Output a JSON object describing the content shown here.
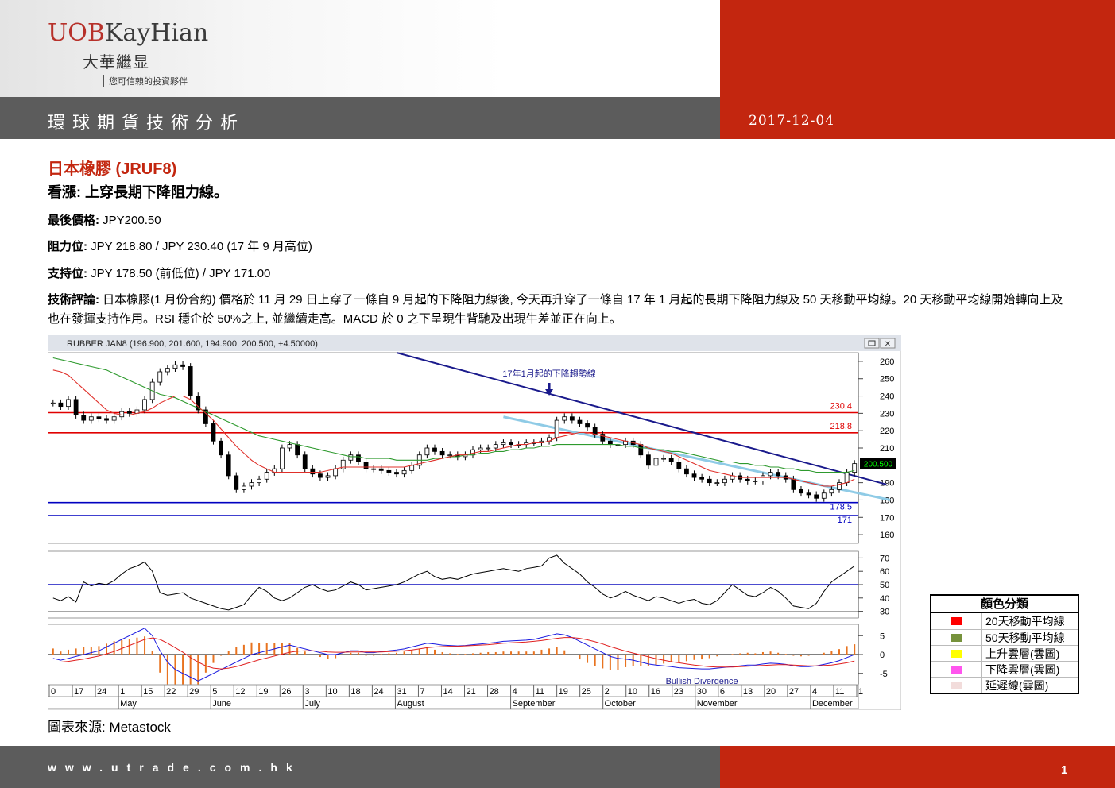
{
  "header": {
    "logo_brand_a": "UOB",
    "logo_brand_b": "KayHian",
    "logo_cn": "大華繼显",
    "logo_slogan": "您可信賴的投資夥伴",
    "band_title": "環球期貨技術分析",
    "date": "2017-12-04"
  },
  "report": {
    "title": "日本橡膠 (JRUF8)",
    "outlook": "看漲: 上穿長期下降阻力線。",
    "last_price_label": "最後價格:",
    "last_price": "JPY200.50",
    "resistance_label": "阻力位:",
    "resistance": "JPY 218.80  / JPY 230.40  (17 年 9 月高位)",
    "support_label": "支持位:",
    "support": "JPY 178.50 (前低位) / JPY 171.00",
    "commentary_label": "技術評論:",
    "commentary": "日本橡膠(1 月份合約) 價格於 11 月 29 日上穿了一條自 9 月起的下降阻力線後, 今天再升穿了一條自 17 年 1 月起的長期下降阻力線及 50 天移動平均線。20 天移動平均線開始轉向上及也在發揮支持作用。RSI 穩企於 50%之上, 並繼續走高。MACD 於 0 之下呈現牛背馳及出現牛差並正在向上。"
  },
  "chart_data": {
    "type": "line",
    "title": "RUBBER JAN8 (196.900, 201.600, 194.900, 200.500, +4.50000)",
    "annotation": "17年1月起的下降趨勢線",
    "macd_annotation": "Bullish Divergence",
    "last_value_label": "200.500",
    "price_axis_ticks": [
      260,
      250,
      240,
      230,
      220,
      210,
      190,
      180,
      170,
      160
    ],
    "rsi_axis_ticks": [
      70,
      60,
      50,
      40,
      30
    ],
    "macd_axis_ticks": [
      5,
      0,
      -5
    ],
    "price_ylim": [
      155,
      265
    ],
    "rsi_ylim": [
      25,
      75
    ],
    "macd_ylim": [
      -8,
      8
    ],
    "horizontal_lines": [
      {
        "value": 230.4,
        "label": "230.4",
        "color": "#e00000"
      },
      {
        "value": 218.8,
        "label": "218.8",
        "color": "#e00000"
      },
      {
        "value": 178.5,
        "label": "178.5",
        "color": "#0000c0"
      },
      {
        "value": 171,
        "label": "171",
        "color": "#0000c0"
      }
    ],
    "date_ticks": [
      "0",
      "17",
      "24",
      "1",
      "15",
      "22",
      "29",
      "5",
      "12",
      "19",
      "26",
      "3",
      "10",
      "18",
      "24",
      "31",
      "7",
      "14",
      "21",
      "28",
      "4",
      "11",
      "19",
      "25",
      "2",
      "10",
      "16",
      "23",
      "30",
      "6",
      "13",
      "20",
      "27",
      "4",
      "11",
      "1"
    ],
    "month_labels": [
      "May",
      "June",
      "July",
      "August",
      "September",
      "October",
      "November",
      "December"
    ],
    "close": [
      236,
      234,
      238,
      229,
      226,
      228,
      227,
      226,
      228,
      231,
      230,
      232,
      238,
      248,
      254,
      256,
      258,
      257,
      240,
      232,
      224,
      214,
      206,
      194,
      186,
      188,
      190,
      192,
      196,
      198,
      210,
      212,
      206,
      198,
      195,
      193,
      194,
      198,
      203,
      206,
      202,
      198,
      198,
      197,
      196,
      195,
      197,
      200,
      206,
      210,
      208,
      206,
      206,
      205,
      206,
      209,
      210,
      210,
      212,
      213,
      212,
      212,
      213,
      213,
      214,
      216,
      226,
      228,
      226,
      224,
      222,
      218,
      214,
      212,
      212,
      214,
      212,
      206,
      200,
      204,
      204,
      202,
      198,
      195,
      193,
      192,
      190,
      190,
      192,
      194,
      192,
      191,
      191,
      194,
      196,
      194,
      192,
      186,
      184,
      183,
      181,
      184,
      186,
      190,
      196,
      201
    ],
    "ma20": [
      255,
      254,
      252,
      248,
      244,
      240,
      236,
      232,
      230,
      229,
      229,
      230,
      231,
      233,
      236,
      238,
      240,
      240,
      238,
      234,
      230,
      226,
      221,
      216,
      211,
      207,
      203,
      200,
      198,
      196,
      196,
      196,
      196,
      196,
      196,
      196,
      197,
      198,
      199,
      199,
      199,
      199,
      199,
      199,
      199,
      199,
      199,
      200,
      201,
      202,
      203,
      204,
      205,
      206,
      206,
      207,
      208,
      208,
      209,
      210,
      211,
      212,
      212,
      213,
      213,
      214,
      216,
      217,
      218,
      219,
      219,
      218,
      217,
      216,
      215,
      214,
      213,
      212,
      210,
      209,
      208,
      207,
      205,
      203,
      201,
      199,
      197,
      196,
      195,
      194,
      193,
      193,
      193,
      193,
      193,
      193,
      193,
      192,
      191,
      190,
      189,
      188,
      188,
      189,
      190,
      192
    ],
    "ma50": [
      262,
      261,
      260,
      259,
      258,
      257,
      256,
      255,
      253,
      251,
      249,
      247,
      245,
      243,
      241,
      240,
      239,
      237,
      235,
      233,
      231,
      229,
      227,
      225,
      223,
      221,
      219,
      217,
      216,
      215,
      214,
      213,
      212,
      211,
      210,
      209,
      208,
      207,
      206,
      205,
      205,
      204,
      204,
      204,
      204,
      203,
      203,
      203,
      203,
      203,
      204,
      204,
      205,
      205,
      206,
      206,
      207,
      207,
      208,
      208,
      209,
      209,
      210,
      210,
      211,
      211,
      212,
      212,
      212,
      212,
      212,
      212,
      212,
      212,
      212,
      211,
      211,
      210,
      210,
      209,
      209,
      208,
      208,
      207,
      206,
      205,
      204,
      203,
      202,
      202,
      201,
      201,
      200,
      200,
      199,
      199,
      198,
      198,
      197,
      197,
      196,
      196,
      196,
      196,
      196,
      197
    ],
    "rsi": [
      40,
      38,
      41,
      37,
      52,
      49,
      51,
      50,
      53,
      58,
      62,
      64,
      67,
      60,
      44,
      42,
      43,
      44,
      40,
      38,
      36,
      34,
      32,
      31,
      33,
      35,
      42,
      48,
      45,
      40,
      38,
      40,
      44,
      48,
      50,
      47,
      45,
      46,
      49,
      52,
      50,
      46,
      47,
      48,
      49,
      50,
      52,
      55,
      58,
      60,
      56,
      54,
      55,
      54,
      56,
      58,
      59,
      60,
      61,
      62,
      61,
      60,
      62,
      63,
      64,
      70,
      72,
      66,
      62,
      58,
      52,
      48,
      43,
      40,
      42,
      45,
      42,
      40,
      38,
      41,
      40,
      38,
      36,
      38,
      39,
      36,
      35,
      38,
      44,
      50,
      46,
      42,
      41,
      44,
      48,
      45,
      40,
      34,
      33,
      32,
      36,
      45,
      52,
      56,
      60,
      64
    ],
    "macd": [
      -1,
      -1.5,
      -1,
      -0.5,
      0,
      0.5,
      1,
      2,
      3,
      4,
      5,
      6,
      7,
      5,
      1,
      -2,
      -4,
      -5,
      -6,
      -7,
      -6,
      -5,
      -4,
      -3,
      -2,
      -1,
      0,
      0.5,
      1,
      1.5,
      2,
      2.5,
      2,
      1.5,
      1,
      0.5,
      0,
      0,
      0.5,
      1,
      1,
      0.5,
      0.5,
      0.8,
      1,
      1.2,
      1.5,
      2,
      2.5,
      3,
      2.8,
      2.5,
      2.4,
      2.3,
      2.4,
      2.6,
      2.8,
      3,
      3.2,
      3.5,
      3.6,
      3.7,
      3.8,
      4,
      4.5,
      5,
      5.5,
      5.2,
      4.5,
      3.5,
      2.5,
      1.5,
      0.5,
      -0.5,
      -1,
      -1.2,
      -1.5,
      -2,
      -2.5,
      -2.8,
      -3,
      -3.2,
      -3.5,
      -3.6,
      -3.7,
      -3.8,
      -3.8,
      -3.6,
      -3.4,
      -3.2,
      -3,
      -2.8,
      -2.8,
      -2.5,
      -2.3,
      -2.4,
      -2.6,
      -3,
      -3.2,
      -3.2,
      -3,
      -2.6,
      -2.2,
      -1.6,
      -0.8,
      0
    ],
    "macd_signal": [
      -2,
      -2,
      -1.8,
      -1.5,
      -1.2,
      -0.8,
      -0.4,
      0.2,
      0.8,
      1.6,
      2.4,
      3.2,
      4,
      4.4,
      4,
      3,
      1.8,
      0.6,
      -0.8,
      -2,
      -3,
      -3.6,
      -3.8,
      -3.6,
      -3.2,
      -2.6,
      -2,
      -1.4,
      -0.9,
      -0.4,
      0.1,
      0.6,
      0.9,
      1,
      1,
      0.9,
      0.7,
      0.6,
      0.6,
      0.7,
      0.7,
      0.7,
      0.7,
      0.7,
      0.8,
      0.9,
      1,
      1.2,
      1.5,
      1.8,
      2,
      2.1,
      2.2,
      2.2,
      2.3,
      2.4,
      2.5,
      2.6,
      2.8,
      3,
      3.1,
      3.2,
      3.3,
      3.5,
      3.7,
      4,
      4.3,
      4.5,
      4.5,
      4.3,
      3.9,
      3.4,
      2.8,
      2.1,
      1.5,
      0.9,
      0.4,
      -0.1,
      -0.6,
      -1.1,
      -1.5,
      -1.9,
      -2.2,
      -2.5,
      -2.8,
      -3,
      -3.2,
      -3.3,
      -3.3,
      -3.3,
      -3.2,
      -3.1,
      -3,
      -2.9,
      -2.8,
      -2.7,
      -2.7,
      -2.8,
      -2.9,
      -3,
      -3,
      -2.9,
      -2.8,
      -2.5,
      -2.2,
      -1.7
    ]
  },
  "chart_source": "圖表來源: Metastock",
  "legend": {
    "title": "顏色分類",
    "items": [
      {
        "color": "#ff0000",
        "label": "20天移動平均線"
      },
      {
        "color": "#76923c",
        "label": "50天移動平均線"
      },
      {
        "color": "#ffff00",
        "label": "上升雲層(雲圖)"
      },
      {
        "color": "#ff55ee",
        "label": "下降雲層(雲圖)"
      },
      {
        "color": "#f2dcdb",
        "label": "延遲線(雲圖)"
      }
    ]
  },
  "footer": {
    "url": "www.utrade.com.hk",
    "page": "1"
  }
}
